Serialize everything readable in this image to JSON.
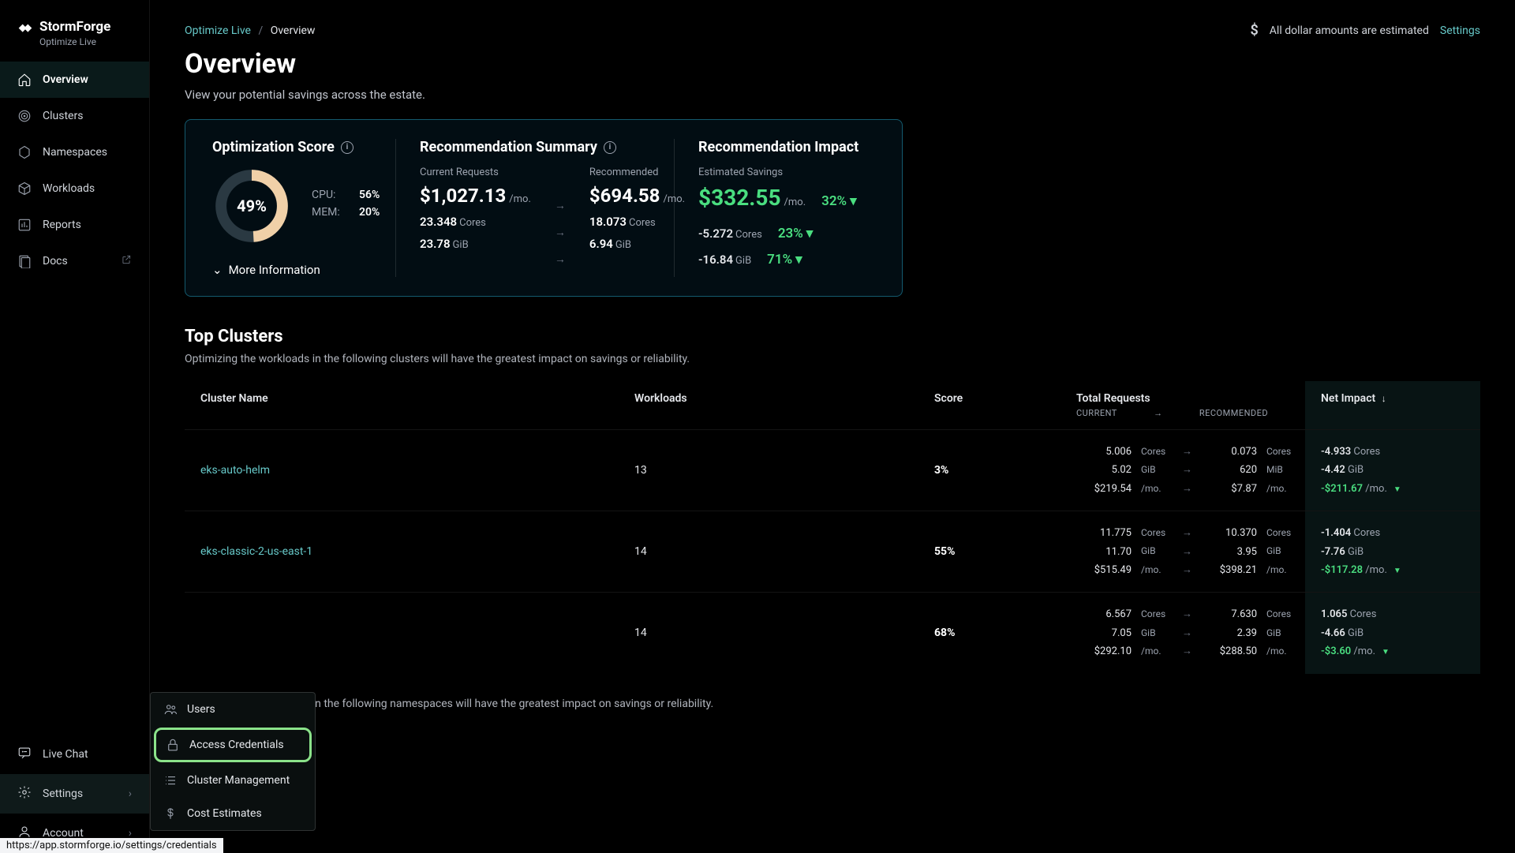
{
  "brand": {
    "name": "StormForge",
    "sub": "Optimize Live"
  },
  "nav": [
    {
      "label": "Overview",
      "icon": "home-icon",
      "active": true
    },
    {
      "label": "Clusters",
      "icon": "target-icon"
    },
    {
      "label": "Namespaces",
      "icon": "hexagon-icon"
    },
    {
      "label": "Workloads",
      "icon": "box-icon"
    },
    {
      "label": "Reports",
      "icon": "chart-icon"
    },
    {
      "label": "Docs",
      "icon": "docs-icon",
      "external": true
    }
  ],
  "bottomNav": [
    {
      "label": "Live Chat",
      "icon": "chat-icon"
    },
    {
      "label": "Settings",
      "icon": "gear-icon",
      "expand": true,
      "active": true
    },
    {
      "label": "Account",
      "icon": "user-icon",
      "expand": true
    }
  ],
  "settingsMenu": [
    {
      "label": "Users",
      "icon": "users-icon"
    },
    {
      "label": "Access Credentials",
      "icon": "lock-icon",
      "highlight": true
    },
    {
      "label": "Cluster Management",
      "icon": "list-icon"
    },
    {
      "label": "Cost Estimates",
      "icon": "dollar-icon"
    }
  ],
  "statusBarUrl": "https://app.stormforge.io/settings/credentials",
  "breadcrumb": {
    "root": "Optimize Live",
    "current": "Overview"
  },
  "topRight": {
    "note": "All dollar amounts are estimated",
    "settings": "Settings"
  },
  "page": {
    "title": "Overview",
    "subtitle": "View your potential savings across the estate."
  },
  "opt": {
    "heading": "Optimization Score",
    "score": "49%",
    "scoreNum": 49,
    "cpu": {
      "label": "CPU:",
      "value": "56%"
    },
    "mem": {
      "label": "MEM:",
      "value": "20%"
    },
    "moreInfo": "More Information"
  },
  "rec": {
    "heading": "Recommendation Summary",
    "currentLabel": "Current Requests",
    "recommendedLabel": "Recommended",
    "currentCost": "$1,027.13",
    "recommendedCost": "$694.58",
    "permo": "/mo.",
    "currentCores": "23.348",
    "recCores": "18.073",
    "coresUnit": "Cores",
    "currentGiB": "23.78",
    "recGiB": "6.94",
    "gibUnit": "GiB"
  },
  "impact": {
    "heading": "Recommendation Impact",
    "savingsLabel": "Estimated Savings",
    "savings": "$332.55",
    "savingsPct": "32%",
    "cores": "-5.272",
    "coresUnit": "Cores",
    "coresPct": "23%",
    "gib": "-16.84",
    "gibUnit": "GiB",
    "gibPct": "71%"
  },
  "topClusters": {
    "title": "Top Clusters",
    "subtitle": "Optimizing the workloads in the following clusters will have the greatest impact on savings or reliability.",
    "headers": {
      "name": "Cluster Name",
      "workloads": "Workloads",
      "score": "Score",
      "requests": "Total Requests",
      "current": "CURRENT",
      "recommended": "RECOMMENDED",
      "impact": "Net Impact"
    },
    "rows": [
      {
        "name": "eks-auto-helm",
        "workloads": "13",
        "score": "3%",
        "curCores": "5.006",
        "recCores": "0.073",
        "curGiB": "5.02",
        "recGiB": "620",
        "recGiBUnit": "MiB",
        "curCost": "$219.54",
        "recCost": "$7.87",
        "impCores": "-4.933",
        "impGiB": "-4.42",
        "impCost": "-$211.67"
      },
      {
        "name": "eks-classic-2-us-east-1",
        "workloads": "14",
        "score": "55%",
        "curCores": "11.775",
        "recCores": "10.370",
        "curGiB": "11.70",
        "recGiB": "3.95",
        "recGiBUnit": "GiB",
        "curCost": "$515.49",
        "recCost": "$398.21",
        "impCores": "-1.404",
        "impGiB": "-7.76",
        "impCost": "-$117.28"
      },
      {
        "name": "",
        "workloads": "14",
        "score": "68%",
        "curCores": "6.567",
        "recCores": "7.630",
        "curGiB": "7.05",
        "recGiB": "2.39",
        "recGiBUnit": "GiB",
        "curCost": "$292.10",
        "recCost": "$288.50",
        "impCores": "1.065",
        "impGiB": "-4.66",
        "impCost": "-$3.60"
      }
    ]
  },
  "topNamespaces": {
    "subtitle": "Optimizing the workloads in the following namespaces will have the greatest impact on savings or reliability."
  },
  "units": {
    "cores": "Cores",
    "gib": "GiB",
    "permo": "/mo."
  }
}
